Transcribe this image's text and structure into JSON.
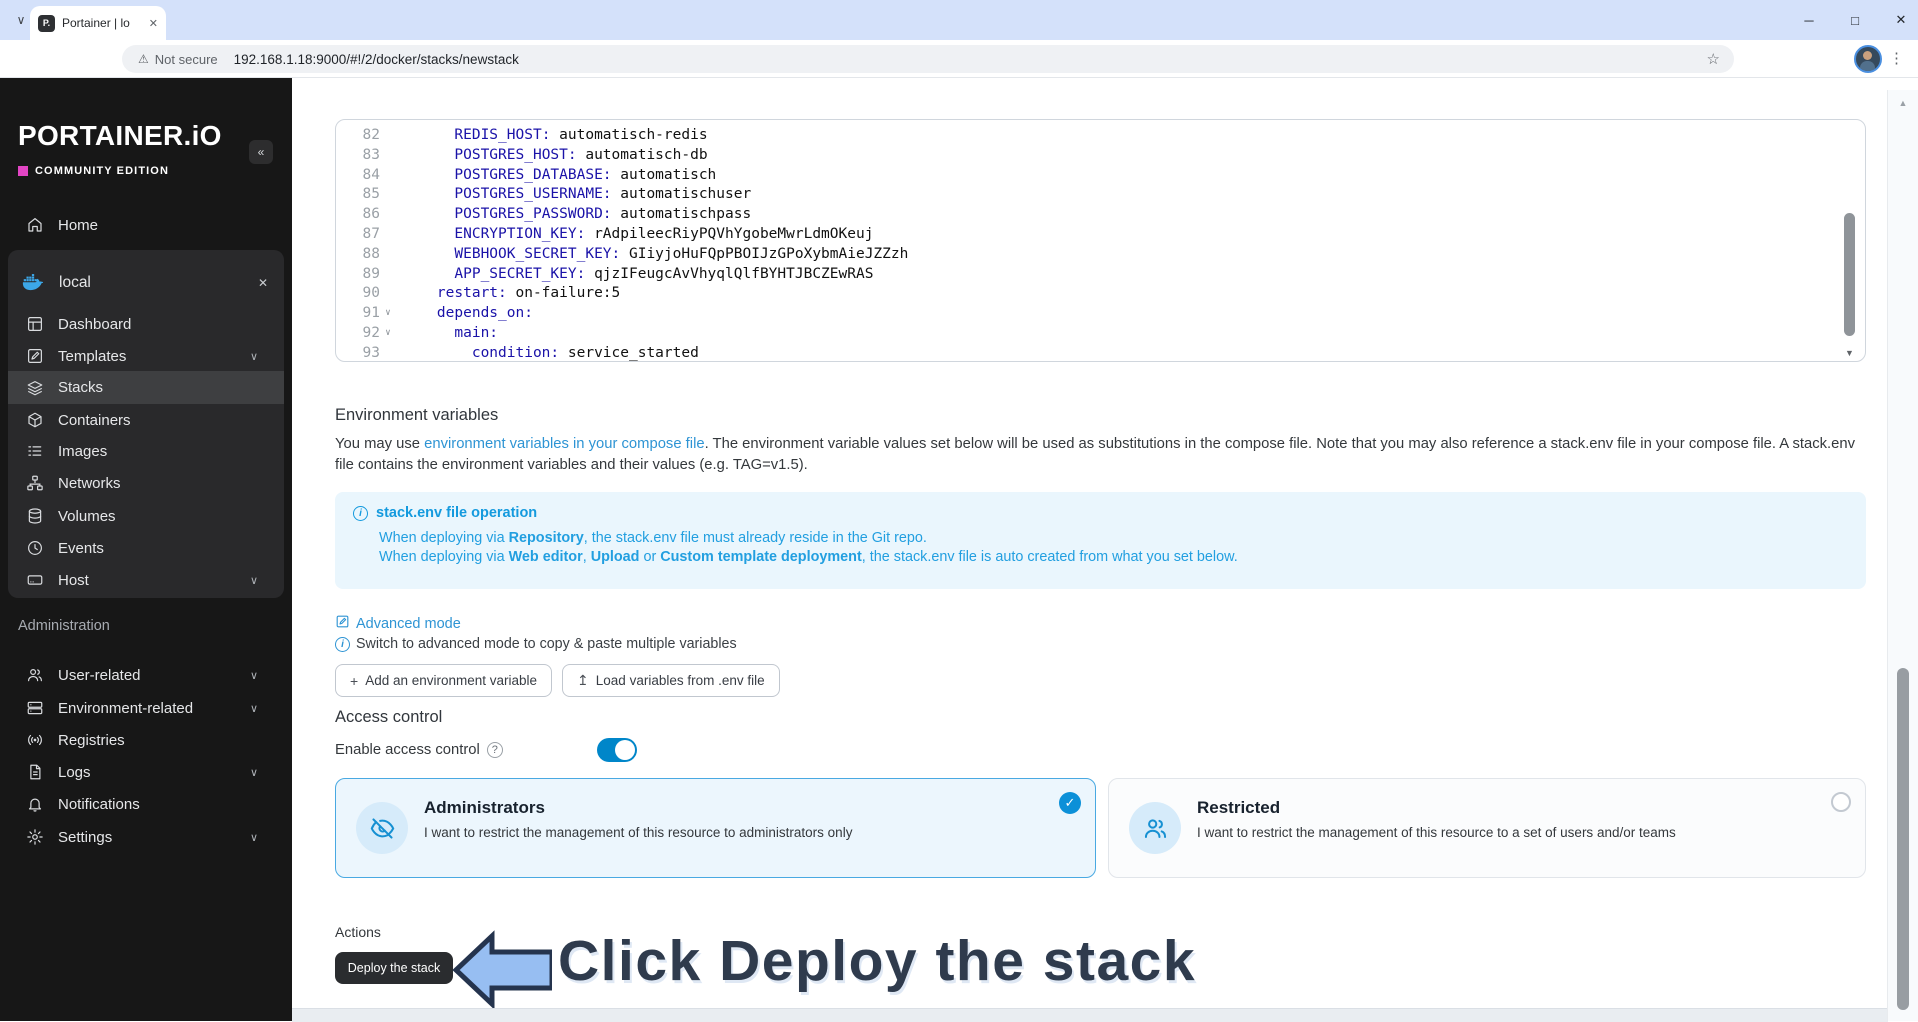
{
  "browser": {
    "tab_title": "Portainer | lo",
    "favicon_text": "P.",
    "security_label": "Not secure",
    "url": "192.168.1.18:9000/#!/2/docker/stacks/newstack"
  },
  "icons": {
    "chevron_down": "∨",
    "close": "✕",
    "minimize": "─",
    "maximize": "□",
    "back": "←",
    "forward": "→",
    "reload": "↻",
    "warning": "⚠",
    "star": "☆",
    "menu_dots": "⋮",
    "collapse": "«",
    "scroll_up": "▲",
    "scroll_down": "▼",
    "plus": "+",
    "upload": "↥",
    "check": "✓",
    "info_i": "i",
    "question": "?"
  },
  "colors": {
    "accent_blue": "#0086c9",
    "link_blue": "#2e94d4",
    "magenta": "#e245c4",
    "docker_blue": "#3ca7e8"
  },
  "sidebar": {
    "logo": "PORTAINER.iO",
    "edition": "COMMUNITY EDITION",
    "home_label": "Home",
    "endpoint_label": "local",
    "menu": [
      {
        "label": "Dashboard"
      },
      {
        "label": "Templates"
      },
      {
        "label": "Stacks"
      },
      {
        "label": "Containers"
      },
      {
        "label": "Images"
      },
      {
        "label": "Networks"
      },
      {
        "label": "Volumes"
      },
      {
        "label": "Events"
      },
      {
        "label": "Host"
      }
    ],
    "admin_label": "Administration",
    "admin": [
      {
        "label": "User-related"
      },
      {
        "label": "Environment-related"
      },
      {
        "label": "Registries"
      },
      {
        "label": "Logs"
      },
      {
        "label": "Notifications"
      },
      {
        "label": "Settings"
      }
    ]
  },
  "editor": {
    "lines": [
      {
        "n": "82",
        "f": "",
        "i": "      ",
        "k": "REDIS_HOST:",
        "v": " automatisch-redis"
      },
      {
        "n": "83",
        "f": "",
        "i": "      ",
        "k": "POSTGRES_HOST:",
        "v": " automatisch-db"
      },
      {
        "n": "84",
        "f": "",
        "i": "      ",
        "k": "POSTGRES_DATABASE:",
        "v": " automatisch"
      },
      {
        "n": "85",
        "f": "",
        "i": "      ",
        "k": "POSTGRES_USERNAME:",
        "v": " automatischuser"
      },
      {
        "n": "86",
        "f": "",
        "i": "      ",
        "k": "POSTGRES_PASSWORD:",
        "v": " automatischpass"
      },
      {
        "n": "87",
        "f": "",
        "i": "      ",
        "k": "ENCRYPTION_KEY:",
        "v": " rAdpileecRiyPQVhYgobeMwrLdmOKeuj"
      },
      {
        "n": "88",
        "f": "",
        "i": "      ",
        "k": "WEBHOOK_SECRET_KEY:",
        "v": " GIiyjoHuFQpPBOIJzGPoXybmAieJZZzh"
      },
      {
        "n": "89",
        "f": "",
        "i": "      ",
        "k": "APP_SECRET_KEY:",
        "v": " qjzIFeugcAvVhyqlQlfBYHTJBCZEwRAS"
      },
      {
        "n": "90",
        "f": "",
        "i": "    ",
        "k": "restart:",
        "v": " on-failure:5"
      },
      {
        "n": "91",
        "f": "∨",
        "i": "    ",
        "k": "depends_on:",
        "v": ""
      },
      {
        "n": "92",
        "f": "∨",
        "i": "      ",
        "k": "main:",
        "v": ""
      },
      {
        "n": "93",
        "f": "",
        "i": "        ",
        "k": "condition:",
        "v": " service_started"
      }
    ]
  },
  "env": {
    "title": "Environment variables",
    "intro_pre": "You may use ",
    "intro_link": "environment variables in your compose file",
    "intro_post": ". The environment variable values set below will be used as substitutions in the compose file. Note that you may also reference a stack.env file in your compose file. A stack.env file contains the environment variables and their values (e.g. TAG=v1.5).",
    "info_title": "stack.env file operation",
    "l1a": "When deploying via ",
    "l1b": "Repository",
    "l1c": ", the stack.env file must already reside in the Git repo.",
    "l2a": "When deploying via ",
    "l2b": "Web editor",
    "l2c": ", ",
    "l2d": "Upload",
    "l2e": " or ",
    "l2f": "Custom template deployment",
    "l2g": ", the stack.env file is auto created from what you set below.",
    "advanced_label": "Advanced mode",
    "hint": "Switch to advanced mode to copy & paste multiple variables",
    "btn_add": "Add an environment variable",
    "btn_load": "Load variables from .env file"
  },
  "access": {
    "title": "Access control",
    "enable_label": "Enable access control",
    "admins_title": "Administrators",
    "admins_desc": "I want to restrict the management of this resource to administrators only",
    "restricted_title": "Restricted",
    "restricted_desc": "I want to restrict the management of this resource to a set of users and/or teams"
  },
  "actions": {
    "label": "Actions",
    "deploy_label": "Deploy the stack",
    "annotation": "Click Deploy the stack"
  }
}
